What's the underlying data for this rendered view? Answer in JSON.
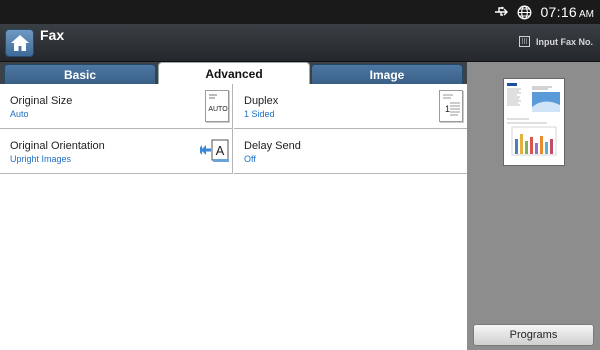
{
  "status": {
    "time": "07:16",
    "ampm": "AM"
  },
  "header": {
    "title": "Fax",
    "input_fax_label": "Input Fax No."
  },
  "tabs": [
    {
      "label": "Basic",
      "active": false
    },
    {
      "label": "Advanced",
      "active": true
    },
    {
      "label": "Image",
      "active": false
    }
  ],
  "options": {
    "original_size": {
      "label": "Original Size",
      "value": "Auto",
      "icon_text": "AUTO"
    },
    "duplex": {
      "label": "Duplex",
      "value": "1 Sided",
      "icon_text": "1"
    },
    "original_orientation": {
      "label": "Original Orientation",
      "value": "Upright Images",
      "icon_text": "A"
    },
    "delay_send": {
      "label": "Delay Send",
      "value": "Off"
    }
  },
  "preview": {
    "brand": "SAMSUNG"
  },
  "programs_label": "Programs",
  "colors": {
    "accent": "#1f6fc4",
    "tab_blue": "#4d78a4",
    "header_dark": "#2d3135"
  }
}
